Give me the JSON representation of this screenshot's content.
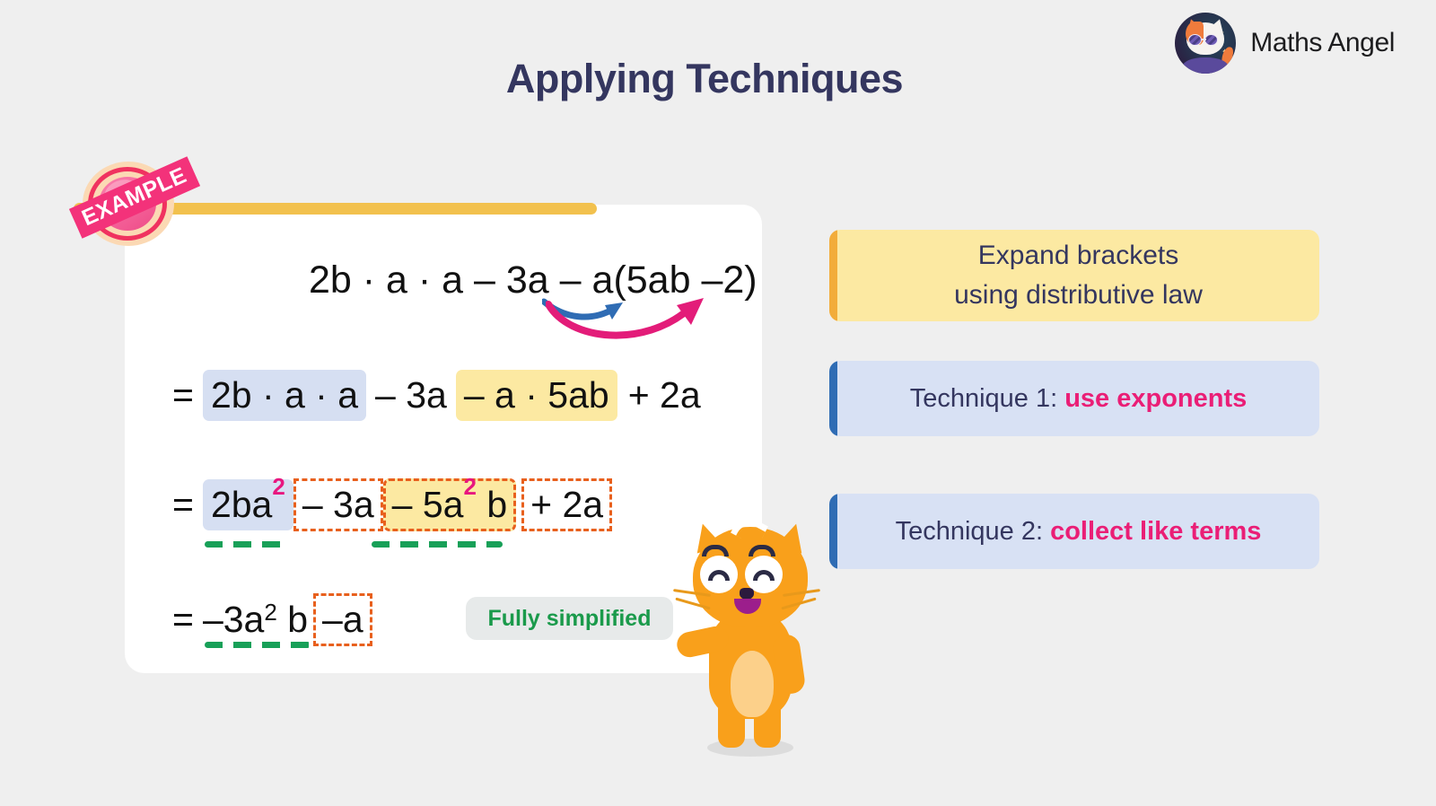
{
  "brand": {
    "name": "Maths Angel",
    "logo_icon": "cat-mascot-logo-icon"
  },
  "header": {
    "title": "Applying Techniques"
  },
  "stamp": {
    "label": "EXAMPLE"
  },
  "work": {
    "line1": {
      "text": "2b · a · a – 3a – a(5ab –2)",
      "arrows": [
        {
          "name": "distribute-arrow-blue",
          "color": "#2f6cb4",
          "target": "5ab"
        },
        {
          "name": "distribute-arrow-pink",
          "color": "#e31c79",
          "target": "-2"
        }
      ]
    },
    "line2": {
      "eq": "=",
      "parts": [
        {
          "text": "2b · a · a",
          "highlight": "blue"
        },
        {
          "text": "– 3a",
          "highlight": "none"
        },
        {
          "text": "– a · 5ab",
          "highlight": "yellow"
        },
        {
          "text": "+ 2a",
          "highlight": "none"
        }
      ]
    },
    "line3": {
      "eq": "=",
      "parts": [
        {
          "base": "2ba",
          "exp": "2",
          "highlight": "blue",
          "dashed": false
        },
        {
          "base": "– 3a",
          "exp": "",
          "highlight": "none",
          "dashed": true
        },
        {
          "base": "– 5a",
          "exp": "2",
          "suffix": " b",
          "highlight": "yellow",
          "dashed": true
        },
        {
          "base": "+ 2a",
          "exp": "",
          "highlight": "none",
          "dashed": true
        }
      ]
    },
    "line4": {
      "eq": "=",
      "base": "–3a",
      "exp": "2",
      "suffix": " b",
      "boxed": "–a"
    },
    "badge": {
      "label": "Fully simplified"
    }
  },
  "notes": [
    {
      "name": "note-expand-brackets",
      "line1": "Expand brackets",
      "line2": "using distributive law",
      "bg": "#fce9a2",
      "bar": "#f2ac3a"
    },
    {
      "name": "note-technique-1",
      "prefix": "Technique 1: ",
      "emphasis": "use exponents",
      "bg": "#d8e1f4",
      "bar": "#2f6cb4"
    },
    {
      "name": "note-technique-2",
      "prefix": "Technique 2: ",
      "emphasis": "collect like terms",
      "bg": "#d8e1f4",
      "bar": "#2f6cb4"
    }
  ],
  "colors": {
    "background": "#efefef",
    "title": "#34365f",
    "accent_pink": "#ea1e76",
    "exponent_pink": "#e8167f",
    "dashed_orange": "#e8601d",
    "underline_green": "#18a058",
    "badge_green": "#1a9a4b",
    "card_yellow_bar": "#f2c14e"
  },
  "mascot": {
    "name": "orange-cat-mascot"
  }
}
